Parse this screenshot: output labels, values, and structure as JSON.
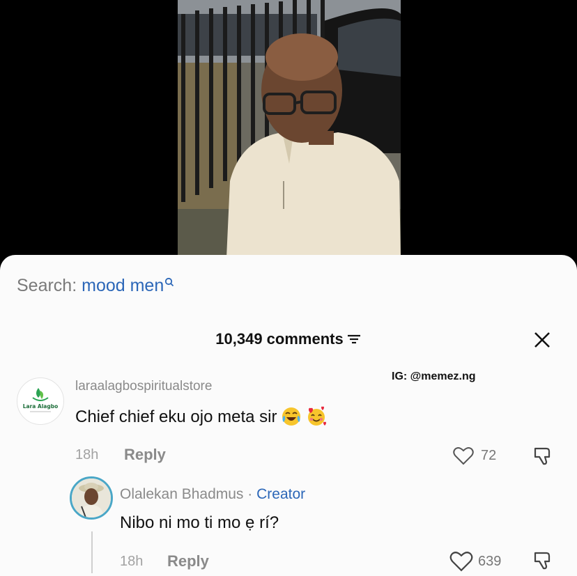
{
  "search": {
    "prefix": "Search:",
    "query": "mood men"
  },
  "comments_header": {
    "count_text": "10,349 comments"
  },
  "watermark": "IG: @memez.ng",
  "comment1": {
    "username": "laraalagbospiritualstore",
    "avatar_logo_text": "Lara Alagbo",
    "text": "Chief chief eku ojo meta sir",
    "emojis": [
      "face-with-tears-of-joy-emoji",
      "smiling-face-with-hearts-emoji"
    ],
    "time": "18h",
    "reply_label": "Reply",
    "likes": "72"
  },
  "reply1": {
    "username": "Olalekan Bhadmus",
    "separator": "·",
    "badge": "Creator",
    "text": "Nibo ni mo ti mo ẹ rí?",
    "time": "18h",
    "reply_label": "Reply",
    "likes": "639"
  },
  "colors": {
    "accent_blue": "#2c67b8",
    "avatar_ring": "#4aa7c7",
    "sheet_bg": "#fbfbfb"
  }
}
